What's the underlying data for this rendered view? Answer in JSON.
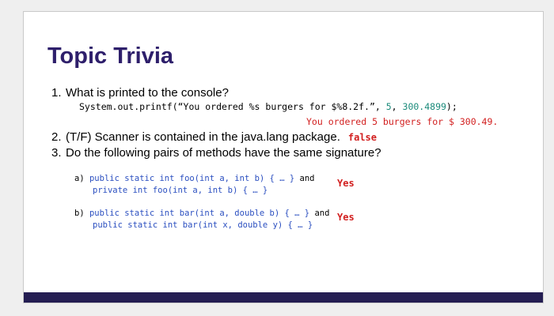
{
  "title": "Topic Trivia",
  "q1": {
    "number": "1.",
    "text": "What is printed to the console?",
    "code_prefix": "System.out.printf(",
    "code_string": "“You ordered %s burgers for $%8.2f.”",
    "code_sep1": ", ",
    "code_arg1": "5",
    "code_sep2": ", ",
    "code_arg2": "300.4899",
    "code_suffix": ");",
    "answer": "You ordered 5 burgers for $  300.49."
  },
  "q2": {
    "number": "2.",
    "text": "(T/F) Scanner is contained in the java.lang package.",
    "answer": "false"
  },
  "q3": {
    "number": "3.",
    "text": "Do the following pairs of methods have the same signature?",
    "a": {
      "label": "a)",
      "line1": "public static int foo(int a, int b) { … }",
      "line1_and": " and",
      "line2": "private int foo(int a, int b) { … }",
      "answer": "Yes"
    },
    "b": {
      "label": "b)",
      "line1": "public static int bar(int a, double b) { … }",
      "line1_and": " and",
      "line2": "public static int bar(int x, double y) { … }",
      "answer": "Yes"
    }
  }
}
